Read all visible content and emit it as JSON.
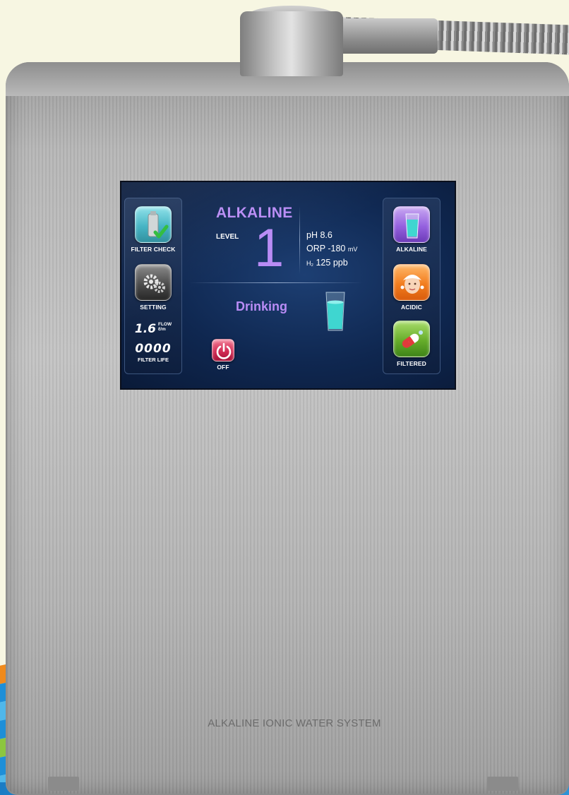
{
  "device": {
    "brand_text": "ALKALINE IONIC WATER SYSTEM"
  },
  "screen": {
    "left_panel": {
      "filter_check_label": "FILTER CHECK",
      "setting_label": "SETTING",
      "flow_value": "1.6",
      "flow_unit_top": "FLOW",
      "flow_unit_bottom": "ℓ/m",
      "filter_life_value": "0000",
      "filter_life_label": "FILTER LIFE"
    },
    "main": {
      "mode_title": "ALKALINE",
      "level_label": "LEVEL",
      "level_value": "1",
      "ph_label": "pH",
      "ph_value": "8.6",
      "orp_label": "ORP",
      "orp_value": "-180",
      "orp_unit": "mV",
      "h2_label": "H₂",
      "h2_value": "125",
      "h2_unit": "ppb",
      "usage": "Drinking",
      "off_label": "OFF"
    },
    "right_panel": {
      "alkaline_label": "ALKALINE",
      "acidic_label": "ACIDIC",
      "filtered_label": "FILTERED"
    }
  },
  "colors": {
    "accent_purple": "#b98cf5",
    "screen_bg": "#0f2750",
    "water_teal": "#3fd6d0"
  }
}
